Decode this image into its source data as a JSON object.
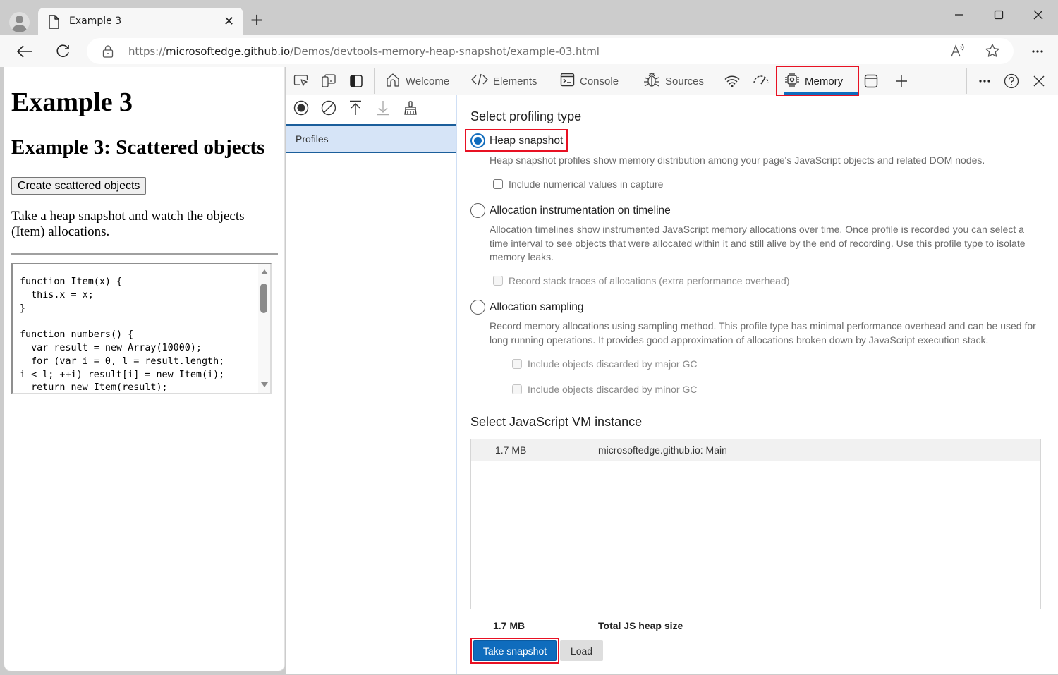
{
  "browser": {
    "tab": {
      "title": "Example 3"
    },
    "address_bar": {
      "url_prefix": "https://",
      "url_domain": "microsoftedge.github.io",
      "url_path": "/Demos/devtools-memory-heap-snapshot/example-03.html"
    },
    "icons": [
      "profile-icon",
      "page-icon",
      "close-tab-icon",
      "new-tab-icon",
      "minimize-icon",
      "maximize-icon",
      "close-window-icon",
      "back-icon",
      "refresh-icon",
      "lock-icon",
      "read-aloud-icon",
      "favorite-star-icon",
      "more-icon"
    ]
  },
  "page": {
    "h1": "Example 3",
    "h2": "Example 3: Scattered objects",
    "button_label": "Create scattered objects",
    "paragraph": "Take a heap snapshot and watch the objects (Item) allocations.",
    "code": "function Item(x) {\n  this.x = x;\n}\n\nfunction numbers() {\n  var result = new Array(10000);\n  for (var i = 0, l = result.length;\ni < l; ++i) result[i] = new Item(i);\n  return new Item(result);"
  },
  "devtools": {
    "tabs": [
      {
        "label": "Welcome",
        "icon": "home-icon"
      },
      {
        "label": "Elements",
        "icon": "code-icon"
      },
      {
        "label": "Console",
        "icon": "console-icon"
      },
      {
        "label": "Sources",
        "icon": "bug-icon"
      },
      {
        "label": "",
        "icon": "network-wifi-icon"
      },
      {
        "label": "",
        "icon": "performance-gauge-icon"
      },
      {
        "label": "Memory",
        "icon": "memory-chip-icon",
        "active": true
      }
    ],
    "sidebar": {
      "tools": [
        "record-icon",
        "clear-icon",
        "load-icon",
        "save-icon",
        "garbage-collect-icon"
      ],
      "section_label": "Profiles"
    },
    "profiling": {
      "heading": "Select profiling type",
      "options": [
        {
          "label": "Heap snapshot",
          "selected": true,
          "description": "Heap snapshot profiles show memory distribution among your page's JavaScript objects and related DOM nodes.",
          "checkboxes": [
            {
              "label": "Include numerical values in capture",
              "checked": false,
              "disabled": false
            }
          ]
        },
        {
          "label": "Allocation instrumentation on timeline",
          "selected": false,
          "description": "Allocation timelines show instrumented JavaScript memory allocations over time. Once profile is recorded you can select a time interval to see objects that were allocated within it and still alive by the end of recording. Use this profile type to isolate memory leaks.",
          "checkboxes": [
            {
              "label": "Record stack traces of allocations (extra performance overhead)",
              "checked": false,
              "disabled": true
            }
          ]
        },
        {
          "label": "Allocation sampling",
          "selected": false,
          "description": "Record memory allocations using sampling method. This profile type has minimal performance overhead and can be used for long running operations. It provides good approximation of allocations broken down by JavaScript execution stack.",
          "checkboxes": [
            {
              "label": "Include objects discarded by major GC",
              "checked": false,
              "disabled": true
            },
            {
              "label": "Include objects discarded by minor GC",
              "checked": false,
              "disabled": true
            }
          ]
        }
      ]
    },
    "vm": {
      "heading": "Select JavaScript VM instance",
      "instances": [
        {
          "size": "1.7 MB",
          "name": "microsoftedge.github.io: Main"
        }
      ],
      "total_size": "1.7 MB",
      "total_label": "Total JS heap size"
    },
    "buttons": {
      "take_snapshot": "Take snapshot",
      "load": "Load"
    },
    "accent_color": "#0f6cbd",
    "highlight_color": "#e81123"
  }
}
